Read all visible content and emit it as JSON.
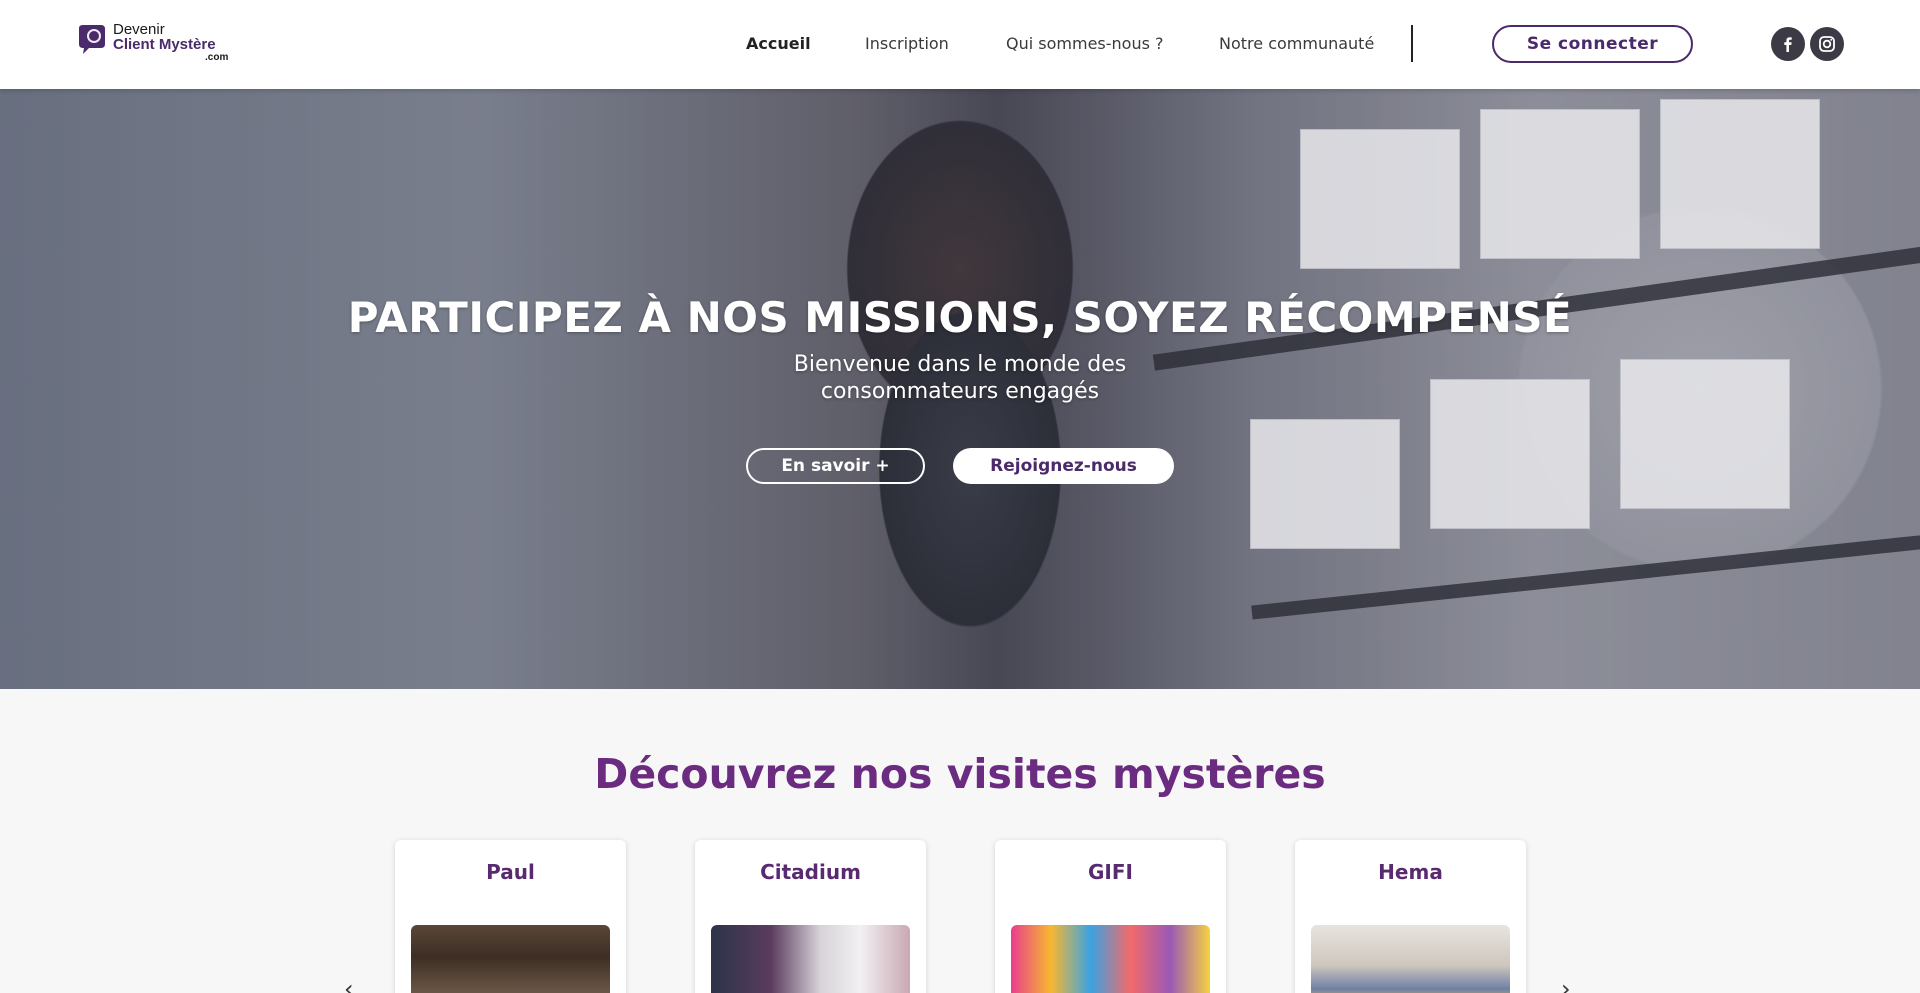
{
  "header": {
    "logo": {
      "line1": "Devenir",
      "line2": "Client Mystère",
      "line3": ".com"
    },
    "nav": [
      {
        "label": "Accueil",
        "active": true
      },
      {
        "label": "Inscription",
        "active": false
      },
      {
        "label": "Qui sommes-nous ?",
        "active": false
      },
      {
        "label": "Notre communauté",
        "active": false
      }
    ],
    "login_label": "Se connecter",
    "social": [
      "facebook-icon",
      "instagram-icon"
    ]
  },
  "hero": {
    "title": "PARTICIPEZ À NOS MISSIONS, SOYEZ RÉCOMPENSÉ",
    "subtitle_line1": "Bienvenue dans le monde des",
    "subtitle_line2": "consommateurs engagés",
    "btn_more": "En savoir +",
    "btn_join": "Rejoignez-nous"
  },
  "section": {
    "title": "Découvrez nos visites mystères",
    "cards": [
      {
        "name": "Paul"
      },
      {
        "name": "Citadium"
      },
      {
        "name": "GIFI"
      },
      {
        "name": "Hema"
      }
    ]
  },
  "colors": {
    "brand": "#4b2a6b",
    "accent": "#6a2b80"
  }
}
